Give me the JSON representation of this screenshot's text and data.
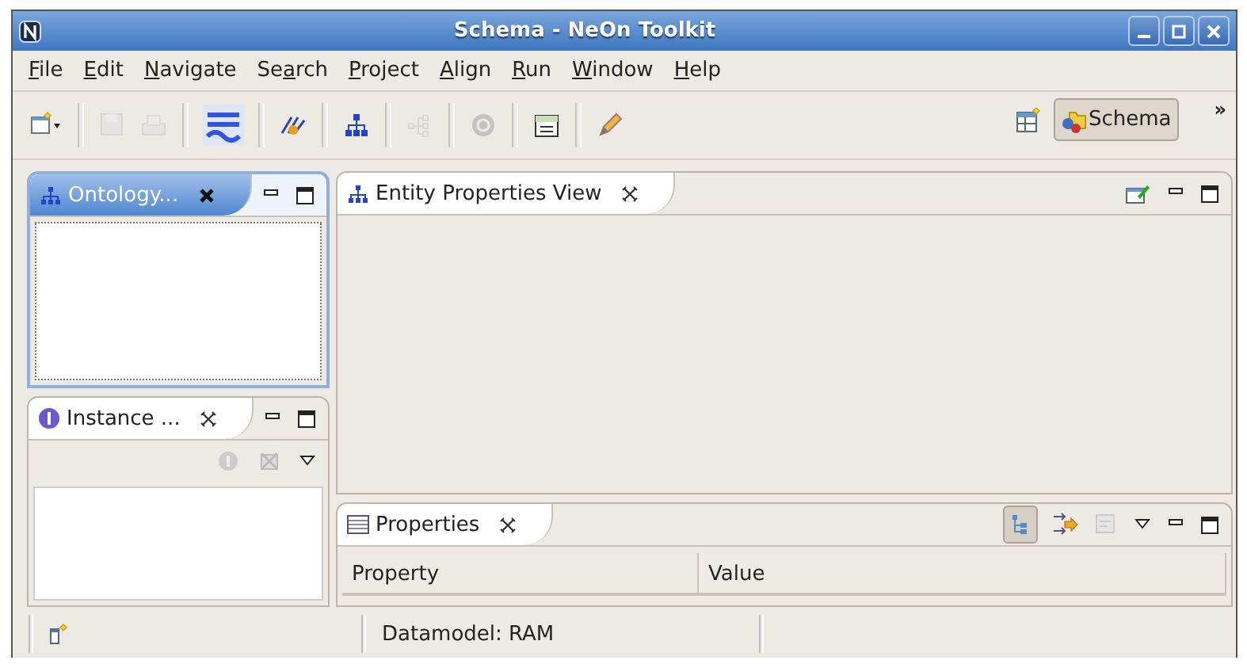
{
  "window": {
    "title": "Schema - NeOn Toolkit"
  },
  "menu": [
    {
      "key": "F",
      "post": "ile"
    },
    {
      "key": "E",
      "post": "dit"
    },
    {
      "key": "N",
      "post": "avigate"
    },
    {
      "pre": "Se",
      "key": "a",
      "post": "rch"
    },
    {
      "key": "P",
      "post": "roject"
    },
    {
      "key": "A",
      "post": "lign"
    },
    {
      "key": "R",
      "post": "un"
    },
    {
      "key": "W",
      "post": "indow"
    },
    {
      "key": "H",
      "post": "elp"
    }
  ],
  "toolbar": [
    {
      "kind": "new",
      "disabled": false
    },
    {
      "kind": "sep"
    },
    {
      "kind": "save",
      "disabled": true
    },
    {
      "kind": "print",
      "disabled": true
    },
    {
      "kind": "sep"
    },
    {
      "kind": "wave",
      "disabled": false
    },
    {
      "kind": "sep"
    },
    {
      "kind": "wand",
      "disabled": false
    },
    {
      "kind": "sep"
    },
    {
      "kind": "tree",
      "disabled": false
    },
    {
      "kind": "sep"
    },
    {
      "kind": "branch",
      "disabled": true
    },
    {
      "kind": "sep"
    },
    {
      "kind": "circle",
      "disabled": true
    },
    {
      "kind": "sep"
    },
    {
      "kind": "doc",
      "disabled": false
    },
    {
      "kind": "sep"
    },
    {
      "kind": "pen",
      "disabled": false
    }
  ],
  "perspective": {
    "label": "Schema",
    "selected": true,
    "more": "»"
  },
  "ontology_view": {
    "tab": "Ontology...",
    "active": true
  },
  "instance_view": {
    "tab": "Instance ..."
  },
  "entity_view": {
    "tab": "Entity Properties View"
  },
  "properties_view": {
    "tab": "Properties",
    "columns": [
      "Property",
      "Value"
    ],
    "tree_mode_selected": true
  },
  "status_bar": {
    "text": "Datamodel: RAM"
  }
}
